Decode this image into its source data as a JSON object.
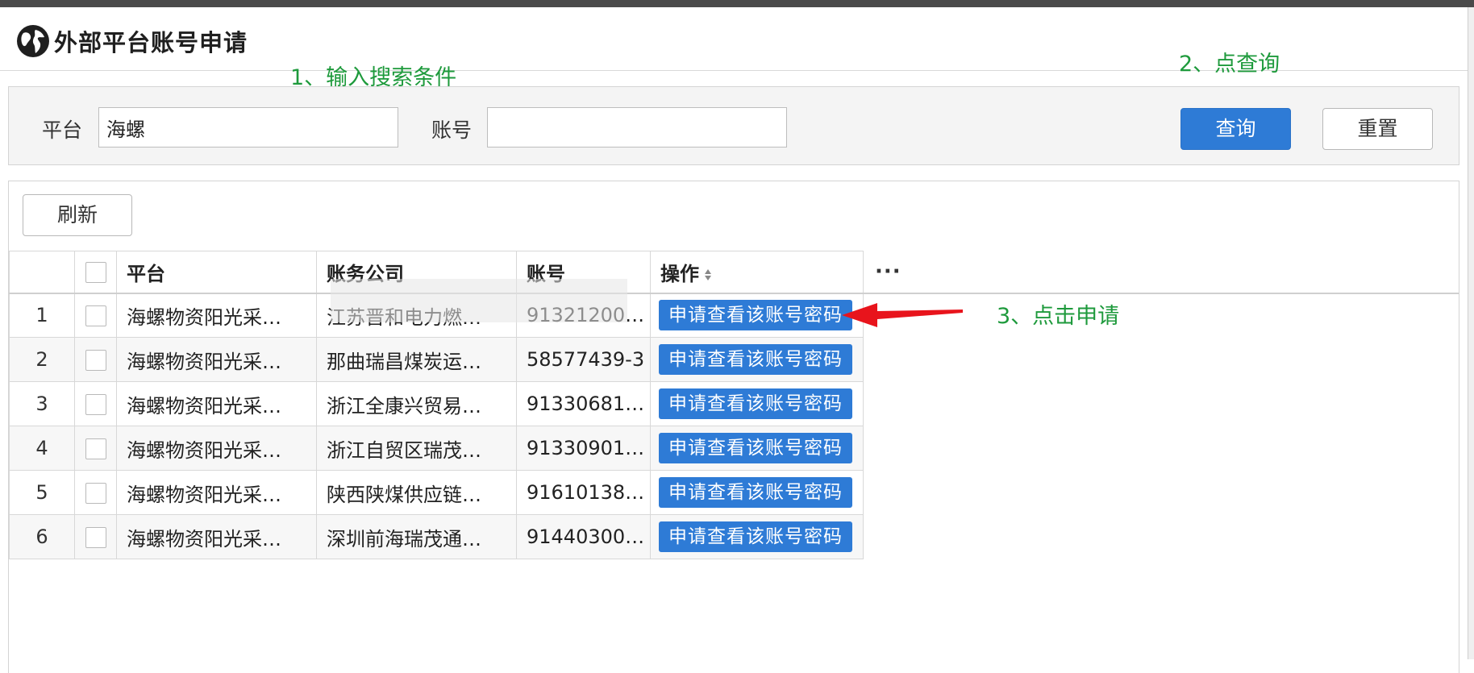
{
  "page": {
    "title": "外部平台账号申请",
    "icon": "globe-icon"
  },
  "annotations": {
    "step1": "1、输入搜索条件",
    "step2": "2、点查询",
    "step3": "3、点击申请"
  },
  "search": {
    "platform_label": "平台",
    "platform_value": "海螺",
    "account_label": "账号",
    "account_value": "",
    "query_button": "查询",
    "reset_button": "重置"
  },
  "toolbar": {
    "refresh_button": "刷新"
  },
  "table": {
    "columns": [
      "平台",
      "账务公司",
      "账号",
      "操作"
    ],
    "more": "···",
    "action_label": "申请查看该账号密码",
    "rows": [
      {
        "index": "1",
        "platform": "海螺物资阳光采…",
        "company": "江苏晋和电力燃…",
        "account": "91321200…"
      },
      {
        "index": "2",
        "platform": "海螺物资阳光采…",
        "company": "那曲瑞昌煤炭运…",
        "account": "58577439-3"
      },
      {
        "index": "3",
        "platform": "海螺物资阳光采…",
        "company": "浙江全康兴贸易…",
        "account": "91330681…"
      },
      {
        "index": "4",
        "platform": "海螺物资阳光采…",
        "company": "浙江自贸区瑞茂…",
        "account": "91330901…"
      },
      {
        "index": "5",
        "platform": "海螺物资阳光采…",
        "company": "陕西陕煤供应链…",
        "account": "91610138…"
      },
      {
        "index": "6",
        "platform": "海螺物资阳光采…",
        "company": "深圳前海瑞茂通…",
        "account": "91440300…"
      }
    ]
  },
  "colors": {
    "primary": "#2e7bd6",
    "annotation": "#1e9a3c",
    "arrow": "#e8141c"
  }
}
